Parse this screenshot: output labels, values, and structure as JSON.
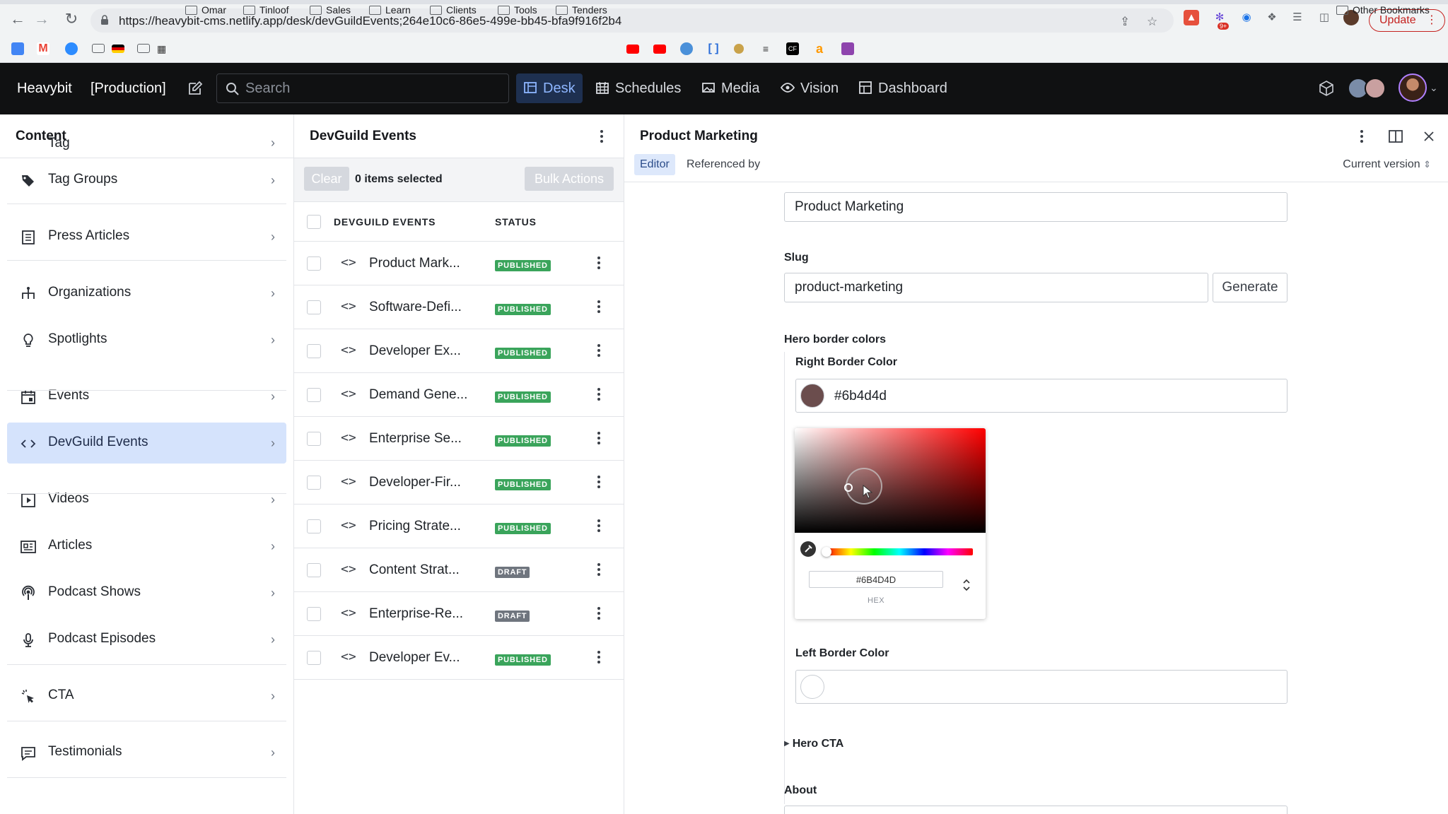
{
  "browser": {
    "url": "https://heavybit-cms.netlify.app/desk/devGuildEvents;264e10c6-86e5-499e-bb45-bfa9f916f2b4",
    "update_label": "Update",
    "bookmarks": [
      "Omar",
      "Tinloof",
      "Sales",
      "Learn",
      "Clients",
      "Tools",
      "Tenders"
    ],
    "other_bookmarks": "Other Bookmarks",
    "ext_badge": "9+"
  },
  "app": {
    "brand": "Heavybit",
    "env": "[Production]",
    "search_placeholder": "Search",
    "tools": [
      {
        "label": "Desk",
        "icon": "desk-icon"
      },
      {
        "label": "Schedules",
        "icon": "calendar-icon"
      },
      {
        "label": "Media",
        "icon": "image-icon"
      },
      {
        "label": "Vision",
        "icon": "eye-icon"
      },
      {
        "label": "Dashboard",
        "icon": "dashboard-icon"
      }
    ]
  },
  "content_pane": {
    "title": "Content",
    "partial_item": "Tag",
    "items": [
      {
        "label": "Tag Groups",
        "icon": "tag-icon"
      },
      {
        "label": "Press Articles",
        "icon": "document-icon"
      },
      {
        "label": "Organizations",
        "icon": "hierarchy-icon"
      },
      {
        "label": "Spotlights",
        "icon": "bulb-icon"
      },
      {
        "label": "Events",
        "icon": "calendar-icon"
      },
      {
        "label": "DevGuild Events",
        "icon": "code-icon",
        "selected": true
      },
      {
        "label": "Videos",
        "icon": "play-icon"
      },
      {
        "label": "Articles",
        "icon": "articles-icon"
      },
      {
        "label": "Podcast Shows",
        "icon": "podcast-icon"
      },
      {
        "label": "Podcast Episodes",
        "icon": "microphone-icon"
      },
      {
        "label": "CTA",
        "icon": "cursor-click-icon"
      },
      {
        "label": "Testimonials",
        "icon": "comment-icon"
      }
    ]
  },
  "list_pane": {
    "title": "DevGuild Events",
    "clear_label": "Clear",
    "selected_count": "0 items selected",
    "bulk_label": "Bulk Actions",
    "col_title": "DEVGUILD EVENTS",
    "col_status": "STATUS",
    "rows": [
      {
        "title": "Product Mark...",
        "status": "PUBLISHED"
      },
      {
        "title": "Software-Defi...",
        "status": "PUBLISHED"
      },
      {
        "title": "Developer Ex...",
        "status": "PUBLISHED"
      },
      {
        "title": "Demand Gene...",
        "status": "PUBLISHED"
      },
      {
        "title": "Enterprise Se...",
        "status": "PUBLISHED"
      },
      {
        "title": "Developer-Fir...",
        "status": "PUBLISHED"
      },
      {
        "title": "Pricing Strate...",
        "status": "PUBLISHED"
      },
      {
        "title": "Content Strat...",
        "status": "DRAFT"
      },
      {
        "title": "Enterprise-Re...",
        "status": "DRAFT"
      },
      {
        "title": "Developer Ev...",
        "status": "PUBLISHED"
      }
    ]
  },
  "editor": {
    "title": "Product Marketing",
    "tab_editor": "Editor",
    "tab_referenced": "Referenced by",
    "version": "Current version",
    "title_value": "Product Marketing",
    "slug_label": "Slug",
    "slug_value": "product-marketing",
    "generate_label": "Generate",
    "hero_border_label": "Hero border colors",
    "right_border_label": "Right Border Color",
    "right_border_value": "#6b4d4d",
    "right_border_color": "#6b4d4d",
    "picker_hex": "#6B4D4D",
    "picker_hex_label": "HEX",
    "left_border_label": "Left Border Color",
    "hero_cta_label": "Hero CTA",
    "about_label": "About"
  }
}
